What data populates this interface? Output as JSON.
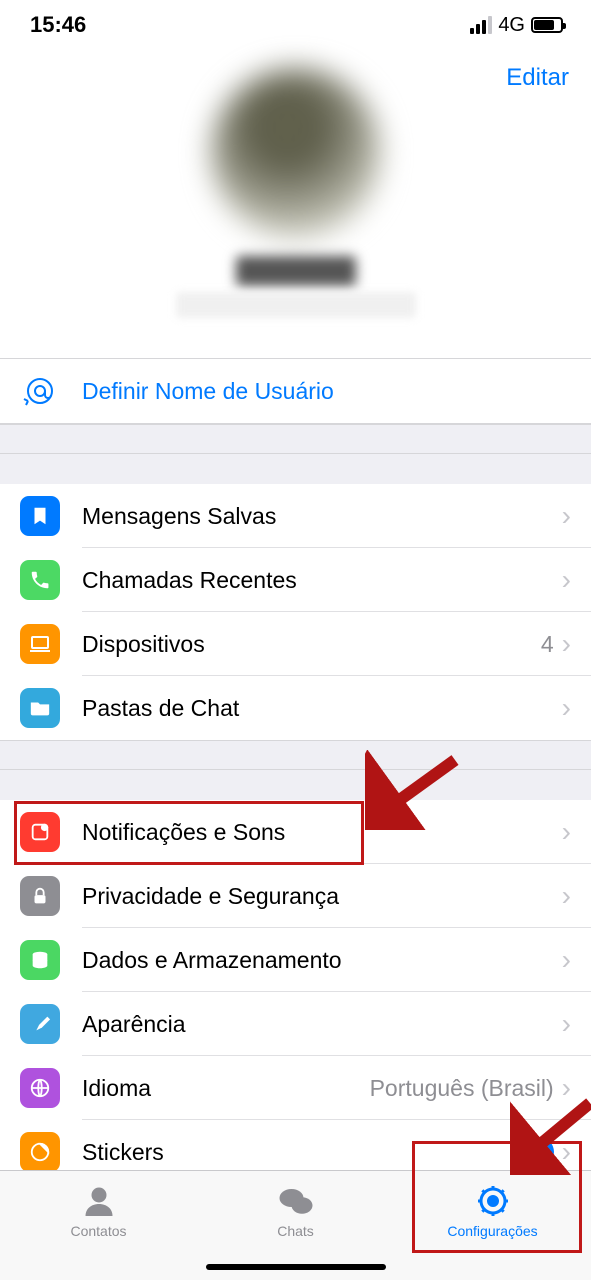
{
  "status": {
    "time": "15:46",
    "network": "4G"
  },
  "header": {
    "edit": "Editar"
  },
  "username_row": {
    "label": "Definir Nome de Usuário"
  },
  "group1": [
    {
      "label": "Mensagens Salvas"
    },
    {
      "label": "Chamadas Recentes"
    },
    {
      "label": "Dispositivos",
      "value": "4"
    },
    {
      "label": "Pastas de Chat"
    }
  ],
  "group2": [
    {
      "label": "Notificações e Sons"
    },
    {
      "label": "Privacidade e Segurança"
    },
    {
      "label": "Dados e Armazenamento"
    },
    {
      "label": "Aparência"
    },
    {
      "label": "Idioma",
      "value": "Português (Brasil)"
    },
    {
      "label": "Stickers",
      "badge": "6"
    }
  ],
  "tabs": {
    "contacts": "Contatos",
    "chats": "Chats",
    "settings": "Configurações"
  }
}
